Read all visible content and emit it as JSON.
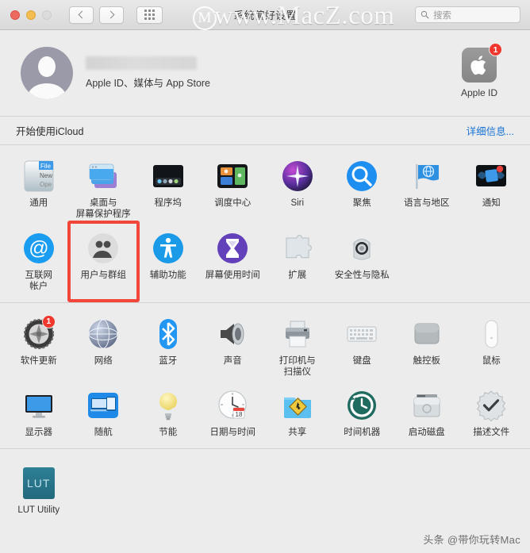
{
  "window": {
    "title": "系统偏好设置",
    "traffic_lights": [
      "close",
      "minimize",
      "zoom"
    ],
    "back_label": "后退",
    "forward_label": "前进",
    "grid_label": "显示全部"
  },
  "search": {
    "placeholder": "搜索",
    "icon": "search-icon"
  },
  "account": {
    "name_redacted": true,
    "subtitle": "Apple ID、媒体与 App Store",
    "apple_id": {
      "label": "Apple ID",
      "icon": "apple-logo-icon",
      "badge": "1"
    }
  },
  "icloud_row": {
    "label": "开始使用iCloud",
    "link": "详细信息...",
    "link_color": "#1873d3"
  },
  "sections": [
    {
      "id": "personal",
      "panes": [
        {
          "label": "通用",
          "icon": "general-icon",
          "badge": null,
          "highlighted": false
        },
        {
          "label": "桌面与\n屏幕保护程序",
          "icon": "desktop-screensaver-icon",
          "badge": null,
          "highlighted": false
        },
        {
          "label": "程序坞",
          "icon": "dock-icon",
          "badge": null,
          "highlighted": false
        },
        {
          "label": "调度中心",
          "icon": "mission-control-icon",
          "badge": null,
          "highlighted": false
        },
        {
          "label": "Siri",
          "icon": "siri-icon",
          "badge": null,
          "highlighted": false
        },
        {
          "label": "聚焦",
          "icon": "spotlight-icon",
          "badge": null,
          "highlighted": false
        },
        {
          "label": "语言与地区",
          "icon": "language-region-icon",
          "badge": null,
          "highlighted": false
        },
        {
          "label": "通知",
          "icon": "notifications-icon",
          "badge": null,
          "highlighted": false
        },
        {
          "label": "互联网\n帐户",
          "icon": "internet-accounts-icon",
          "badge": null,
          "highlighted": false
        },
        {
          "label": "用户与群组",
          "icon": "users-groups-icon",
          "badge": null,
          "highlighted": true
        },
        {
          "label": "辅助功能",
          "icon": "accessibility-icon",
          "badge": null,
          "highlighted": false
        },
        {
          "label": "屏幕使用时间",
          "icon": "screen-time-icon",
          "badge": null,
          "highlighted": false
        },
        {
          "label": "扩展",
          "icon": "extensions-icon",
          "badge": null,
          "highlighted": false
        },
        {
          "label": "安全性与隐私",
          "icon": "security-privacy-icon",
          "badge": null,
          "highlighted": false
        }
      ]
    },
    {
      "id": "hardware",
      "panes": [
        {
          "label": "软件更新",
          "icon": "software-update-icon",
          "badge": "1",
          "highlighted": false
        },
        {
          "label": "网络",
          "icon": "network-icon",
          "badge": null,
          "highlighted": false
        },
        {
          "label": "蓝牙",
          "icon": "bluetooth-icon",
          "badge": null,
          "highlighted": false
        },
        {
          "label": "声音",
          "icon": "sound-icon",
          "badge": null,
          "highlighted": false
        },
        {
          "label": "打印机与\n扫描仪",
          "icon": "printers-scanners-icon",
          "badge": null,
          "highlighted": false
        },
        {
          "label": "键盘",
          "icon": "keyboard-icon",
          "badge": null,
          "highlighted": false
        },
        {
          "label": "触控板",
          "icon": "trackpad-icon",
          "badge": null,
          "highlighted": false
        },
        {
          "label": "鼠标",
          "icon": "mouse-icon",
          "badge": null,
          "highlighted": false
        },
        {
          "label": "显示器",
          "icon": "displays-icon",
          "badge": null,
          "highlighted": false
        },
        {
          "label": "随航",
          "icon": "sidecar-icon",
          "badge": null,
          "highlighted": false
        },
        {
          "label": "节能",
          "icon": "energy-saver-icon",
          "badge": null,
          "highlighted": false
        },
        {
          "label": "日期与时间",
          "icon": "date-time-icon",
          "badge": null,
          "highlighted": false
        },
        {
          "label": "共享",
          "icon": "sharing-icon",
          "badge": null,
          "highlighted": false
        },
        {
          "label": "时间机器",
          "icon": "time-machine-icon",
          "badge": null,
          "highlighted": false
        },
        {
          "label": "启动磁盘",
          "icon": "startup-disk-icon",
          "badge": null,
          "highlighted": false
        },
        {
          "label": "描述文件",
          "icon": "profiles-icon",
          "badge": null,
          "highlighted": false
        }
      ]
    },
    {
      "id": "thirdparty",
      "panes": [
        {
          "label": "LUT Utility",
          "icon": "lut-utility-icon",
          "badge": null,
          "highlighted": false
        }
      ]
    }
  ],
  "watermarks": {
    "top_text": "www.MacZ.com",
    "top_logo": "M",
    "bottom_text": "头条 @带你玩转Mac"
  }
}
